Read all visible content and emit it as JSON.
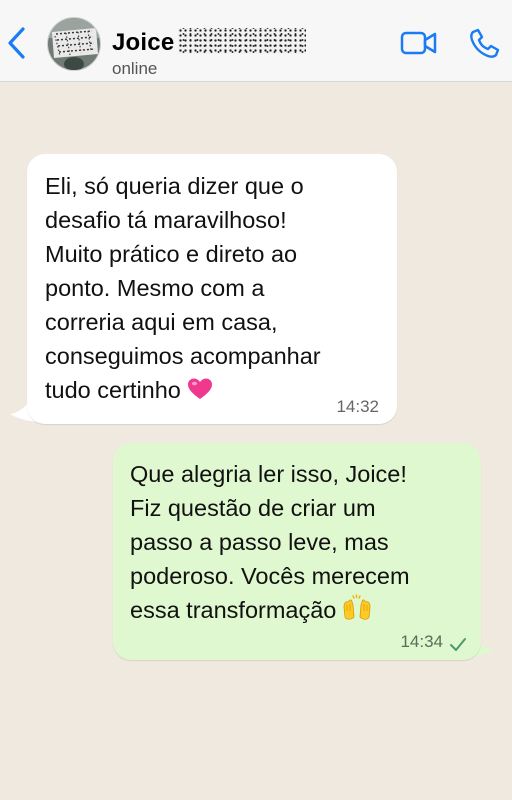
{
  "header": {
    "contact_name": "Joice",
    "status": "online",
    "back_icon": "chevron-left-icon",
    "video_icon": "video-camera-icon",
    "call_icon": "phone-icon",
    "accent_color": "#1a7cf5"
  },
  "messages": [
    {
      "direction": "incoming",
      "lines": [
        "Eli, só queria dizer que o",
        "desafio tá maravilhoso!",
        "Muito prático e direto ao",
        "ponto. Mesmo com a",
        "correria aqui em casa,",
        "conseguimos acompanhar",
        "tudo certinho"
      ],
      "emoji": "pink-heart",
      "time": "14:32",
      "bubble_color": "#ffffff"
    },
    {
      "direction": "outgoing",
      "lines": [
        "Que alegria ler isso, Joice!",
        "Fiz questão de criar um",
        "passo a passo leve, mas",
        "poderoso. Vocês merecem",
        "essa transformação"
      ],
      "emoji": "raising-hands",
      "time": "14:34",
      "status": "sent-single-tick",
      "bubble_color": "#dff8cf"
    }
  ],
  "chat_background": "#efe9df"
}
